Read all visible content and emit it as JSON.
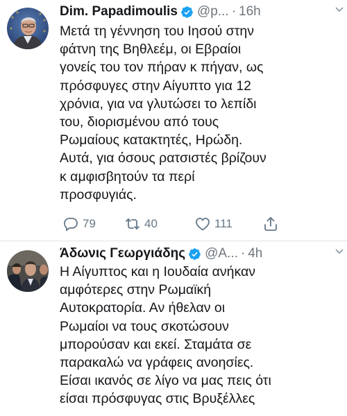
{
  "tweets": [
    {
      "author_name": "Dim. Papadimoulis",
      "handle": "@p...",
      "separator": "·",
      "time": "16h",
      "lines": [
        "Μετά τη γέννηση του Ιησού στην",
        "φάτνη της Βηθλεέμ, οι Εβραίοι",
        "γονείς του τον πήραν κ πήγαν, ως",
        "πρόσφυγες στην Αίγυπτο για 12",
        "χρόνια, για να γλυτώσει το λεπίδι",
        "του, διορισμένου από τους",
        "Ρωμαίους κατακτητές, Ηρώδη.",
        "Αυτά, για όσους  ρατσιστές βρίζουν",
        "κ αμφισβητούν τα περί",
        "προσφυγιάς."
      ],
      "replies": "79",
      "retweets": "40",
      "likes": "111"
    },
    {
      "author_name": "Άδωνις Γεωργιάδης",
      "handle": "@A...",
      "separator": "·",
      "time": "4h",
      "lines": [
        "Η Αίγυπτος και η Ιουδαία ανήκαν",
        "αμφότερες στην Ρωμαϊκή",
        "Αυτοκρατορία. Αν ήθελαν οι",
        "Ρωμαίοι να τους σκοτώσουν",
        "μπορούσαν και εκεί. Σταμάτα σε",
        "παρακαλώ να γράφεις ανοησίες.",
        "Είσαι ικανός σε λίγο να μας πεις ότι",
        "είσαι πρόσφυγας στις Βρυξέλλες"
      ]
    }
  ],
  "colors": {
    "verified": "#1da1f2",
    "muted": "#6e767d",
    "text": "#141619",
    "divider": "#dfe3e7"
  },
  "icons": [
    "verified-badge-icon",
    "chevron-down-icon",
    "reply-icon",
    "retweet-icon",
    "like-icon",
    "share-icon"
  ]
}
